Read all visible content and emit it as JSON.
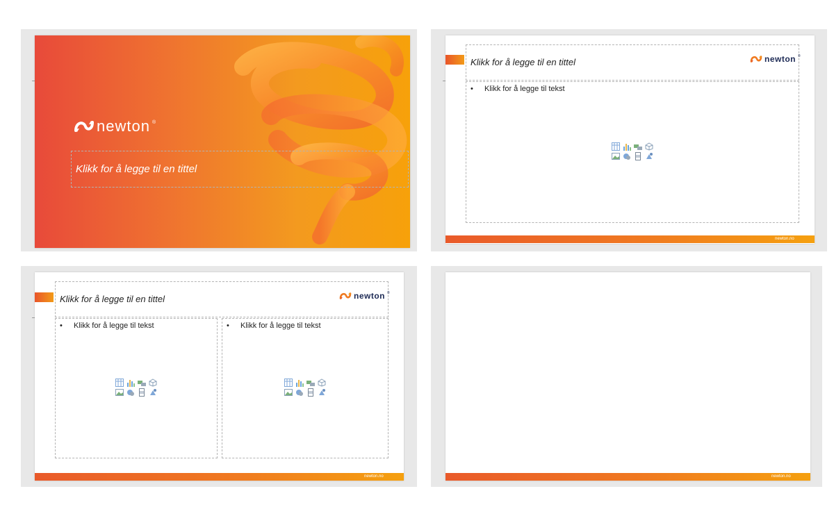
{
  "title_slide": {
    "brand": "newton",
    "brand_mark": "®",
    "title": "Klikk for å legge til en tittel"
  },
  "content_slide": {
    "brand": "newton",
    "brand_mark": "®",
    "title": "Klikk for å legge til en tittel",
    "bullet": "Klikk for å legge til tekst",
    "bullet_symbol": "•",
    "footer": "newton.no"
  },
  "two_content_slide": {
    "brand": "newton",
    "brand_mark": "®",
    "title": "Klikk for å legge til en tittel",
    "bullet_left": "Klikk for å legge til tekst",
    "bullet_right": "Klikk for å legge til tekst",
    "bullet_symbol": "•",
    "footer": "newton.no"
  },
  "blank_slide": {
    "footer": "newton.no"
  },
  "colors": {
    "brand_orange": "#f07a20",
    "brand_navy": "#1d2a55",
    "gradient_start": "#e84a3a",
    "gradient_end": "#f7a10a"
  },
  "placeholder_icons": [
    "table-icon",
    "chart-icon",
    "smartart-icon",
    "3d-model-icon",
    "picture-icon",
    "stock-image-icon",
    "video-icon",
    "icons-icon"
  ]
}
